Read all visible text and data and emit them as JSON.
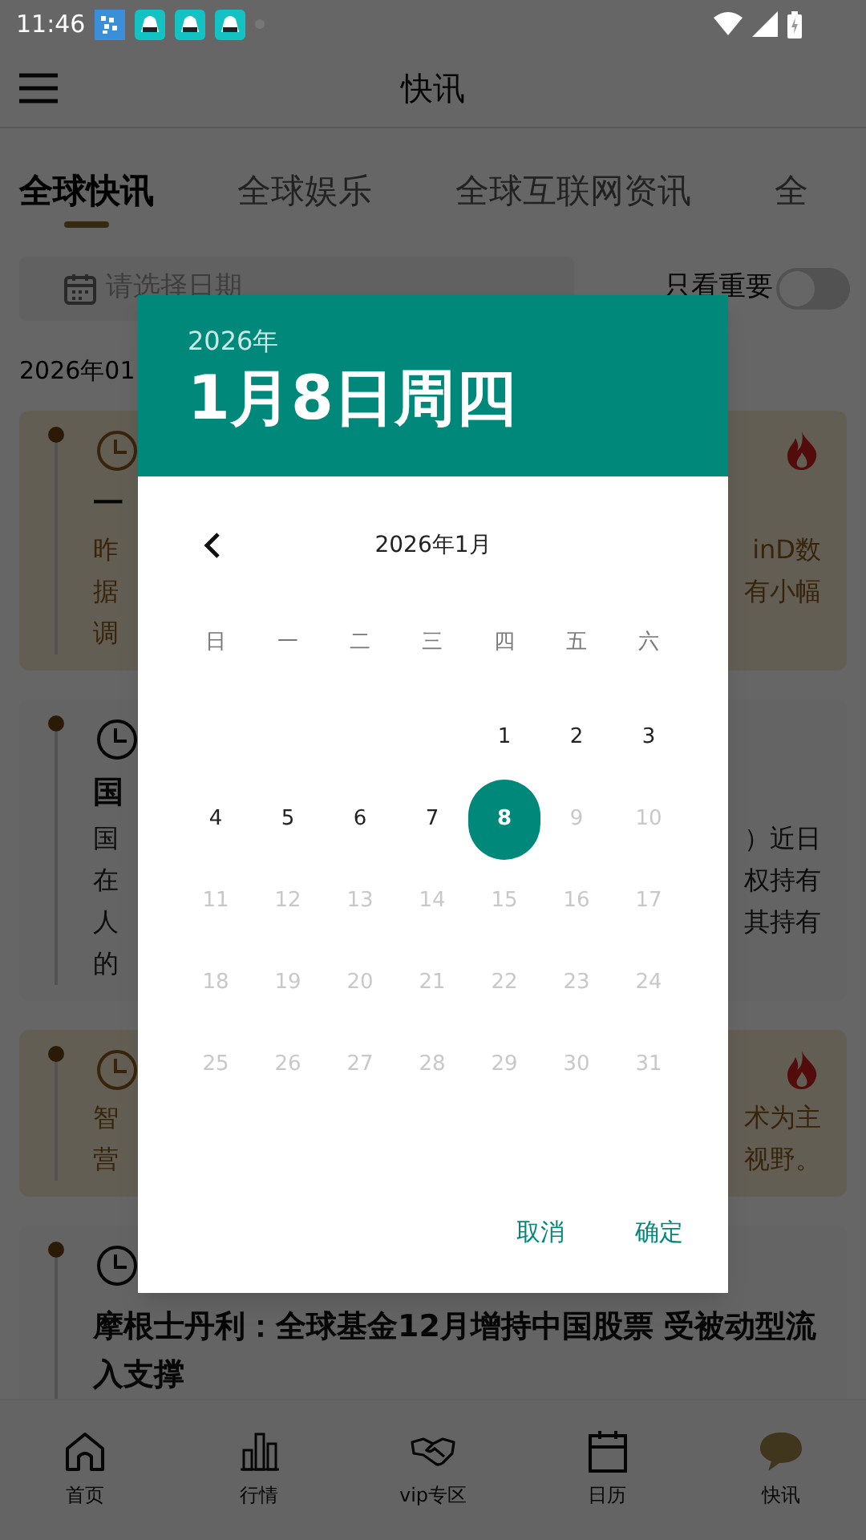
{
  "status_bar": {
    "time": "11:46"
  },
  "header": {
    "title": "快讯"
  },
  "tabs": [
    {
      "label": "全球快讯",
      "selected": true
    },
    {
      "label": "全球娱乐",
      "selected": false
    },
    {
      "label": "全球互联网资讯",
      "selected": false
    },
    {
      "label": "全",
      "selected": false
    }
  ],
  "date_field": {
    "placeholder": "请选择日期"
  },
  "important_toggle": {
    "label": "只看重要",
    "on": false
  },
  "date_heading": "2026年01",
  "news": [
    {
      "highlight": true,
      "hot": true,
      "left_title": "一",
      "left_lines": [
        "昨",
        "据",
        "调"
      ],
      "right_lines": [
        "inD数",
        "有小幅"
      ]
    },
    {
      "highlight": false,
      "hot": false,
      "left_title": "国",
      "left_lines": [
        "国",
        "在",
        "人",
        "的"
      ],
      "right_lines": [
        "）近日",
        "权持有",
        "其持有"
      ]
    },
    {
      "highlight": true,
      "hot": true,
      "left_lines": [
        "智",
        "营"
      ],
      "right_lines": [
        "术为主",
        "视野。"
      ]
    },
    {
      "highlight": false,
      "hot": false,
      "title": "摩根士丹利：全球基金12月增持中国股票 受被动型流入支撑"
    }
  ],
  "bottom_nav": [
    {
      "label": "首页",
      "kind": "home"
    },
    {
      "label": "行情",
      "kind": "chart"
    },
    {
      "label": "vip专区",
      "kind": "handshake"
    },
    {
      "label": "日历",
      "kind": "calendar"
    },
    {
      "label": "快讯",
      "kind": "chat"
    }
  ],
  "date_picker": {
    "year": "2026年",
    "date": "1月8日周四",
    "month": "2026年1月",
    "weekdays": [
      "日",
      "一",
      "二",
      "三",
      "四",
      "五",
      "六"
    ],
    "weeks": [
      [
        {
          "day": "1",
          "disabled": false,
          "selected": false
        },
        {
          "day": "2",
          "disabled": false,
          "selected": false
        },
        {
          "day": "3",
          "disabled": false,
          "selected": false
        }
      ],
      [
        {
          "day": "4",
          "disabled": false,
          "selected": false
        },
        {
          "day": "5",
          "disabled": false,
          "selected": false
        },
        {
          "day": "6",
          "disabled": false,
          "selected": false
        },
        {
          "day": "7",
          "disabled": false,
          "selected": false
        },
        {
          "day": "8",
          "disabled": false,
          "selected": true
        },
        {
          "day": "9",
          "disabled": true,
          "selected": false
        },
        {
          "day": "10",
          "disabled": true,
          "selected": false
        }
      ],
      [
        {
          "day": "11",
          "disabled": true,
          "selected": false
        },
        {
          "day": "12",
          "disabled": true,
          "selected": false
        },
        {
          "day": "13",
          "disabled": true,
          "selected": false
        },
        {
          "day": "14",
          "disabled": true,
          "selected": false
        },
        {
          "day": "15",
          "disabled": true,
          "selected": false
        },
        {
          "day": "16",
          "disabled": true,
          "selected": false
        },
        {
          "day": "17",
          "disabled": true,
          "selected": false
        }
      ],
      [
        {
          "day": "18",
          "disabled": true,
          "selected": false
        },
        {
          "day": "19",
          "disabled": true,
          "selected": false
        },
        {
          "day": "20",
          "disabled": true,
          "selected": false
        },
        {
          "day": "21",
          "disabled": true,
          "selected": false
        },
        {
          "day": "22",
          "disabled": true,
          "selected": false
        },
        {
          "day": "23",
          "disabled": true,
          "selected": false
        },
        {
          "day": "24",
          "disabled": true,
          "selected": false
        }
      ],
      [
        {
          "day": "25",
          "disabled": true,
          "selected": false
        },
        {
          "day": "26",
          "disabled": true,
          "selected": false
        },
        {
          "day": "27",
          "disabled": true,
          "selected": false
        },
        {
          "day": "28",
          "disabled": true,
          "selected": false
        },
        {
          "day": "29",
          "disabled": true,
          "selected": false
        },
        {
          "day": "30",
          "disabled": true,
          "selected": false
        },
        {
          "day": "31",
          "disabled": true,
          "selected": false
        }
      ]
    ],
    "buttons": [
      "取消",
      "确定"
    ]
  }
}
